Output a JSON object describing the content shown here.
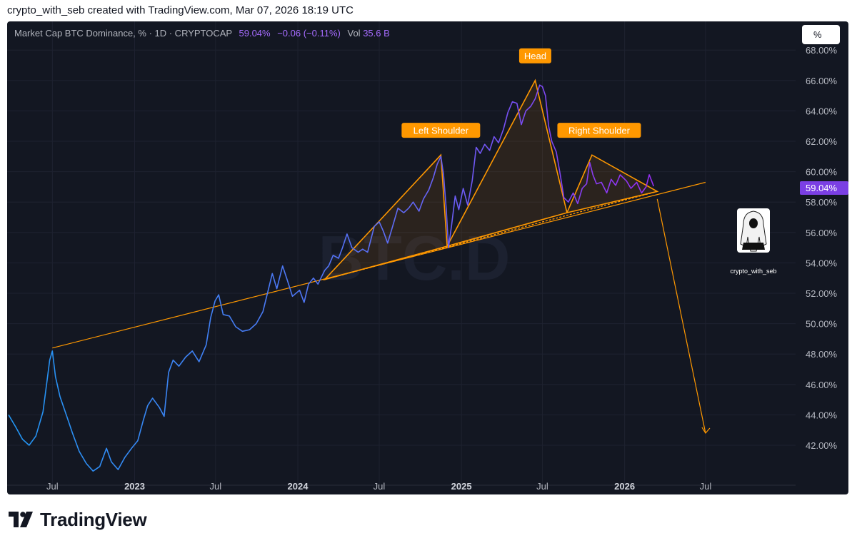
{
  "caption": "crypto_with_seb created with TradingView.com, Mar 07, 2026 18:19 UTC",
  "legend": {
    "symbol": "Market Cap BTC Dominance, % · 1D · CRYPTOCAP",
    "last": "59.04%",
    "change": "−0.06 (−0.11%)",
    "vol_label": "Vol",
    "vol_value": "35.6 B"
  },
  "scale_button": "%",
  "watermark": "BTC.D",
  "price_tag": "59.04%",
  "avatar_label": "crypto_with_seb",
  "brand": "TradingView",
  "colors": {
    "background": "#131722",
    "line_start": "#2196f3",
    "line_end": "#9c27f0",
    "annotation": "#ff9800",
    "price_tag": "#7b3fe4"
  },
  "chart_data": {
    "type": "line",
    "title": "Market Cap BTC Dominance, % · 1D · CRYPTOCAP",
    "ylabel": "%",
    "ylim": [
      40.0,
      69.0
    ],
    "y_ticks": [
      "68.00%",
      "66.00%",
      "64.00%",
      "62.00%",
      "60.00%",
      "58.00%",
      "56.00%",
      "54.00%",
      "52.00%",
      "50.00%",
      "48.00%",
      "46.00%",
      "44.00%",
      "42.00%"
    ],
    "y_tick_values": [
      68,
      66,
      64,
      62,
      60,
      58,
      56,
      54,
      52,
      50,
      48,
      46,
      44,
      42
    ],
    "x_ticks": [
      {
        "label": "Jul",
        "date": "2022-07-01",
        "bold": false
      },
      {
        "label": "2023",
        "date": "2023-01-01",
        "bold": true
      },
      {
        "label": "Jul",
        "date": "2023-07-01",
        "bold": false
      },
      {
        "label": "2024",
        "date": "2024-01-01",
        "bold": true
      },
      {
        "label": "Jul",
        "date": "2024-07-01",
        "bold": false
      },
      {
        "label": "2025",
        "date": "2025-01-01",
        "bold": true
      },
      {
        "label": "Jul",
        "date": "2025-07-01",
        "bold": false
      },
      {
        "label": "2026",
        "date": "2026-01-01",
        "bold": true
      },
      {
        "label": "Jul",
        "date": "2026-07-01",
        "bold": false
      }
    ],
    "series": [
      {
        "name": "Market Cap BTC Dominance",
        "points": [
          [
            "2022-03-25",
            44.0
          ],
          [
            "2022-04-10",
            43.2
          ],
          [
            "2022-04-25",
            42.4
          ],
          [
            "2022-05-10",
            42.0
          ],
          [
            "2022-05-25",
            42.6
          ],
          [
            "2022-06-10",
            44.2
          ],
          [
            "2022-06-18",
            46.0
          ],
          [
            "2022-06-25",
            47.6
          ],
          [
            "2022-07-01",
            48.2
          ],
          [
            "2022-07-08",
            46.5
          ],
          [
            "2022-07-18",
            45.2
          ],
          [
            "2022-08-01",
            44.0
          ],
          [
            "2022-08-15",
            42.8
          ],
          [
            "2022-08-30",
            41.6
          ],
          [
            "2022-09-15",
            40.8
          ],
          [
            "2022-09-30",
            40.3
          ],
          [
            "2022-10-15",
            40.6
          ],
          [
            "2022-10-30",
            41.8
          ],
          [
            "2022-11-10",
            40.9
          ],
          [
            "2022-11-25",
            40.4
          ],
          [
            "2022-12-10",
            41.2
          ],
          [
            "2022-12-25",
            41.8
          ],
          [
            "2023-01-08",
            42.3
          ],
          [
            "2023-01-20",
            43.6
          ],
          [
            "2023-01-30",
            44.6
          ],
          [
            "2023-02-10",
            45.1
          ],
          [
            "2023-02-25",
            44.5
          ],
          [
            "2023-03-08",
            43.9
          ],
          [
            "2023-03-18",
            46.8
          ],
          [
            "2023-03-28",
            47.6
          ],
          [
            "2023-04-10",
            47.2
          ],
          [
            "2023-04-25",
            47.8
          ],
          [
            "2023-05-10",
            48.2
          ],
          [
            "2023-05-25",
            47.5
          ],
          [
            "2023-06-10",
            48.6
          ],
          [
            "2023-06-20",
            50.4
          ],
          [
            "2023-06-30",
            51.5
          ],
          [
            "2023-07-08",
            51.9
          ],
          [
            "2023-07-18",
            50.6
          ],
          [
            "2023-08-01",
            50.5
          ],
          [
            "2023-08-15",
            49.8
          ],
          [
            "2023-08-30",
            49.5
          ],
          [
            "2023-09-15",
            49.6
          ],
          [
            "2023-09-30",
            50.0
          ],
          [
            "2023-10-15",
            50.8
          ],
          [
            "2023-10-25",
            52.0
          ],
          [
            "2023-11-05",
            53.3
          ],
          [
            "2023-11-15",
            52.3
          ],
          [
            "2023-11-28",
            53.8
          ],
          [
            "2023-12-08",
            52.9
          ],
          [
            "2023-12-20",
            51.8
          ],
          [
            "2024-01-05",
            52.2
          ],
          [
            "2024-01-15",
            51.4
          ],
          [
            "2024-01-25",
            52.6
          ],
          [
            "2024-02-05",
            53.0
          ],
          [
            "2024-02-15",
            52.6
          ],
          [
            "2024-03-01",
            53.5
          ],
          [
            "2024-03-10",
            53.8
          ],
          [
            "2024-03-20",
            54.5
          ],
          [
            "2024-04-01",
            54.3
          ],
          [
            "2024-04-10",
            55.0
          ],
          [
            "2024-04-20",
            55.9
          ],
          [
            "2024-05-01",
            55.0
          ],
          [
            "2024-05-15",
            54.7
          ],
          [
            "2024-05-25",
            54.9
          ],
          [
            "2024-06-05",
            54.7
          ],
          [
            "2024-06-20",
            56.4
          ],
          [
            "2024-07-01",
            56.7
          ],
          [
            "2024-07-10",
            56.1
          ],
          [
            "2024-07-20",
            55.3
          ],
          [
            "2024-08-01",
            56.5
          ],
          [
            "2024-08-12",
            57.6
          ],
          [
            "2024-08-25",
            57.3
          ],
          [
            "2024-09-05",
            57.6
          ],
          [
            "2024-09-15",
            58.0
          ],
          [
            "2024-09-28",
            57.4
          ],
          [
            "2024-10-08",
            58.2
          ],
          [
            "2024-10-20",
            58.8
          ],
          [
            "2024-10-30",
            59.6
          ],
          [
            "2024-11-08",
            60.5
          ],
          [
            "2024-11-16",
            61.0
          ],
          [
            "2024-11-22",
            59.8
          ],
          [
            "2024-11-28",
            57.5
          ],
          [
            "2024-12-03",
            55.0
          ],
          [
            "2024-12-10",
            56.5
          ],
          [
            "2024-12-18",
            58.4
          ],
          [
            "2024-12-26",
            57.5
          ],
          [
            "2025-01-05",
            58.9
          ],
          [
            "2025-01-15",
            57.8
          ],
          [
            "2025-01-25",
            59.4
          ],
          [
            "2025-02-03",
            61.6
          ],
          [
            "2025-02-12",
            61.2
          ],
          [
            "2025-02-22",
            61.8
          ],
          [
            "2025-03-05",
            61.4
          ],
          [
            "2025-03-15",
            62.3
          ],
          [
            "2025-03-25",
            61.9
          ],
          [
            "2025-04-05",
            62.8
          ],
          [
            "2025-04-15",
            63.9
          ],
          [
            "2025-04-25",
            64.6
          ],
          [
            "2025-05-05",
            64.5
          ],
          [
            "2025-05-15",
            63.1
          ],
          [
            "2025-05-25",
            64.0
          ],
          [
            "2025-06-05",
            64.3
          ],
          [
            "2025-06-15",
            64.8
          ],
          [
            "2025-06-25",
            65.7
          ],
          [
            "2025-07-01",
            65.6
          ],
          [
            "2025-07-08",
            65.0
          ],
          [
            "2025-07-15",
            63.0
          ],
          [
            "2025-07-22",
            62.0
          ],
          [
            "2025-08-01",
            61.3
          ],
          [
            "2025-08-10",
            59.8
          ],
          [
            "2025-08-18",
            58.3
          ],
          [
            "2025-08-28",
            58.0
          ],
          [
            "2025-09-08",
            58.6
          ],
          [
            "2025-09-18",
            57.9
          ],
          [
            "2025-09-28",
            58.9
          ],
          [
            "2025-10-08",
            59.2
          ],
          [
            "2025-10-15",
            60.6
          ],
          [
            "2025-10-22",
            59.8
          ],
          [
            "2025-10-30",
            59.2
          ],
          [
            "2025-11-10",
            59.3
          ],
          [
            "2025-11-22",
            58.6
          ],
          [
            "2025-12-02",
            59.5
          ],
          [
            "2025-12-12",
            59.1
          ],
          [
            "2025-12-22",
            59.8
          ],
          [
            "2026-01-05",
            59.4
          ],
          [
            "2026-01-15",
            58.9
          ],
          [
            "2026-01-28",
            59.3
          ],
          [
            "2026-02-08",
            58.6
          ],
          [
            "2026-02-18",
            59.0
          ],
          [
            "2026-02-25",
            59.8
          ],
          [
            "2026-03-07",
            59.04
          ]
        ]
      }
    ],
    "annotations": [
      {
        "label": "Left Shoulder",
        "date": "2024-11-16",
        "value": 62.7
      },
      {
        "label": "Head",
        "date": "2025-06-15",
        "value": 67.6
      },
      {
        "label": "Right Shoulder",
        "date": "2025-11-05",
        "value": 62.7
      }
    ],
    "pattern_lines": {
      "trend_line": [
        [
          "2022-07-01",
          48.4
        ],
        [
          "2026-07-01",
          59.3
        ]
      ],
      "neckline": [
        [
          "2024-03-01",
          52.9
        ],
        [
          "2026-03-15",
          58.7
        ]
      ],
      "left_shoulder": [
        [
          "2024-03-01",
          52.9
        ],
        [
          "2024-11-16",
          61.1
        ],
        [
          "2024-11-30",
          55.1
        ]
      ],
      "head": [
        [
          "2024-11-30",
          55.1
        ],
        [
          "2025-06-15",
          66.0
        ],
        [
          "2025-08-25",
          57.3
        ]
      ],
      "right_shoulder": [
        [
          "2025-08-25",
          57.3
        ],
        [
          "2025-10-20",
          61.1
        ],
        [
          "2026-03-15",
          58.7
        ]
      ],
      "projection": [
        [
          "2026-03-15",
          58.2
        ],
        [
          "2026-07-01",
          42.8
        ]
      ]
    }
  }
}
